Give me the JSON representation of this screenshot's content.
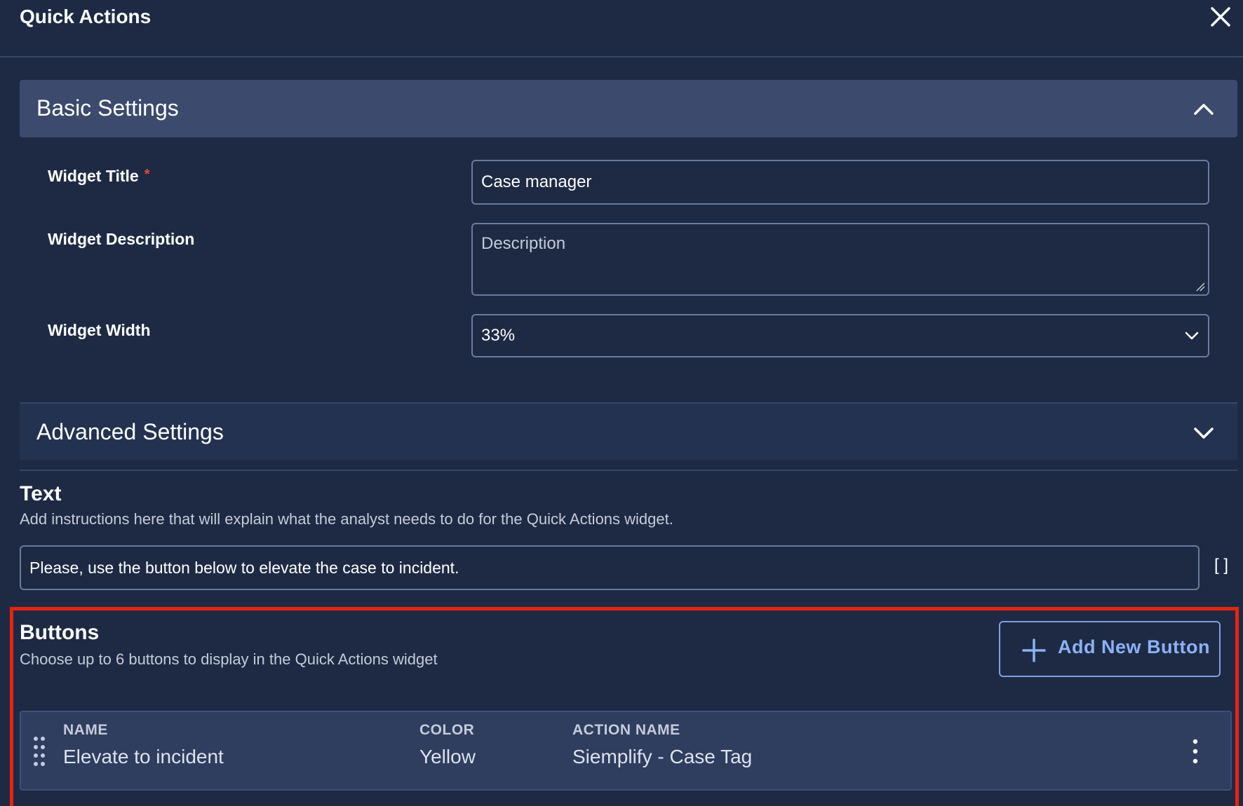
{
  "header": {
    "title": "Quick Actions",
    "close_icon": "close-icon"
  },
  "basic_settings": {
    "title": "Basic Settings",
    "expanded": true,
    "widget_title_label": "Widget Title",
    "required_mark": "*",
    "widget_title_value": "Case manager",
    "widget_description_label": "Widget Description",
    "widget_description_placeholder": "Description",
    "widget_width_label": "Widget Width",
    "widget_width_value": "33%"
  },
  "advanced_settings": {
    "title": "Advanced Settings",
    "expanded": false
  },
  "text_section": {
    "heading": "Text",
    "description": "Add instructions here that will explain what the analyst needs to do for the Quick Actions widget.",
    "value": "Please, use the button below to elevate the case to incident.",
    "bracket_icon": "[ ]"
  },
  "buttons_section": {
    "heading": "Buttons",
    "description": "Choose up to 6 buttons to display in the Quick Actions widget",
    "add_button_label": "Add New Button",
    "columns": {
      "name": "NAME",
      "color": "COLOR",
      "action": "ACTION NAME"
    },
    "rows": [
      {
        "name": "Elevate to incident",
        "color": "Yellow",
        "action": "Siemplify - Case Tag"
      }
    ]
  },
  "colors": {
    "background": "#1e2a44",
    "section_bar": "#3b4a6d",
    "accent": "#8cb2f5",
    "required": "#e8483b",
    "highlight": "#e8240e"
  }
}
